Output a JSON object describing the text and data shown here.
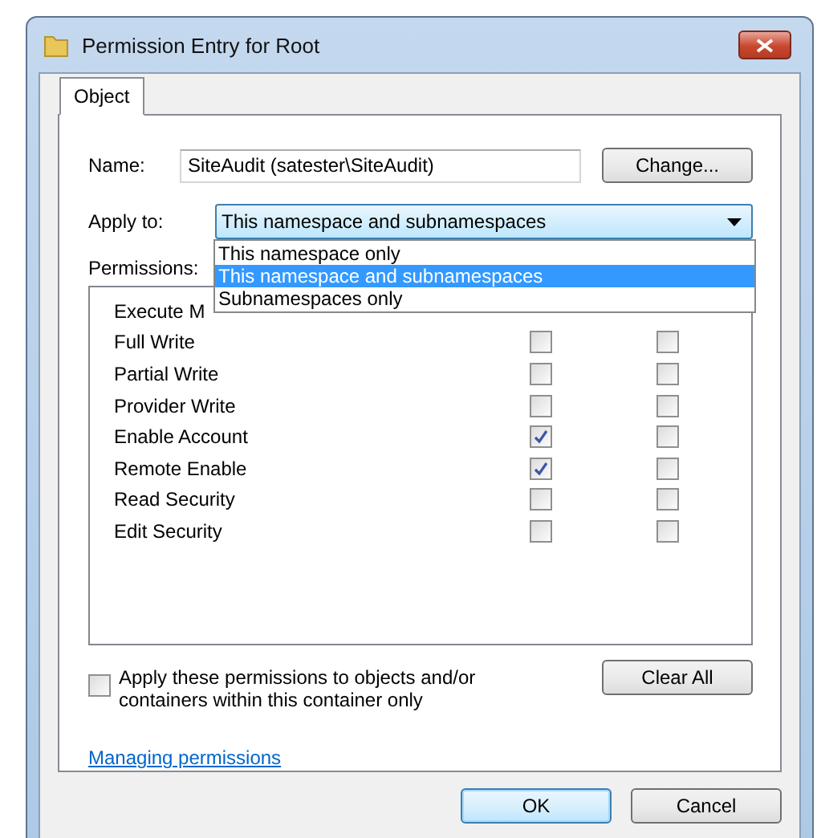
{
  "window": {
    "title": "Permission Entry for Root"
  },
  "tabs": [
    {
      "label": "Object",
      "selected": true
    }
  ],
  "name_field": {
    "label": "Name:",
    "value": "SiteAudit (satester\\SiteAudit)"
  },
  "change_button": "Change...",
  "apply_to": {
    "label": "Apply to:",
    "value": "This namespace and subnamespaces",
    "expanded": true,
    "options": [
      {
        "label": "This namespace only",
        "selected": false
      },
      {
        "label": "This namespace and subnamespaces",
        "selected": true
      },
      {
        "label": "Subnamespaces only",
        "selected": false
      }
    ]
  },
  "permissions": {
    "label": "Permissions:",
    "rows": [
      {
        "label": "Execute M"
      },
      {
        "label": "Full Write",
        "checkboxes": [
          {
            "checked": false
          },
          {
            "checked": false
          }
        ]
      },
      {
        "label": "Partial Write",
        "checkboxes": [
          {
            "checked": false
          },
          {
            "checked": false
          }
        ]
      },
      {
        "label": "Provider Write",
        "checkboxes": [
          {
            "checked": false
          },
          {
            "checked": false
          }
        ]
      },
      {
        "label": "Enable Account",
        "checkboxes": [
          {
            "checked": true
          },
          {
            "checked": false
          }
        ]
      },
      {
        "label": "Remote Enable",
        "checkboxes": [
          {
            "checked": true
          },
          {
            "checked": false
          }
        ]
      },
      {
        "label": "Read Security",
        "checkboxes": [
          {
            "checked": false
          },
          {
            "checked": false
          }
        ]
      },
      {
        "label": "Edit Security",
        "checkboxes": [
          {
            "checked": false
          },
          {
            "checked": false
          }
        ]
      }
    ]
  },
  "apply_within": {
    "label": "Apply these permissions to objects and/or containers within this container only",
    "checked": false
  },
  "clear_all_button": "Clear All",
  "help_link": "Managing permissions",
  "buttons": [
    {
      "label": "OK",
      "kind": "default"
    },
    {
      "label": "Cancel",
      "kind": "normal"
    }
  ]
}
